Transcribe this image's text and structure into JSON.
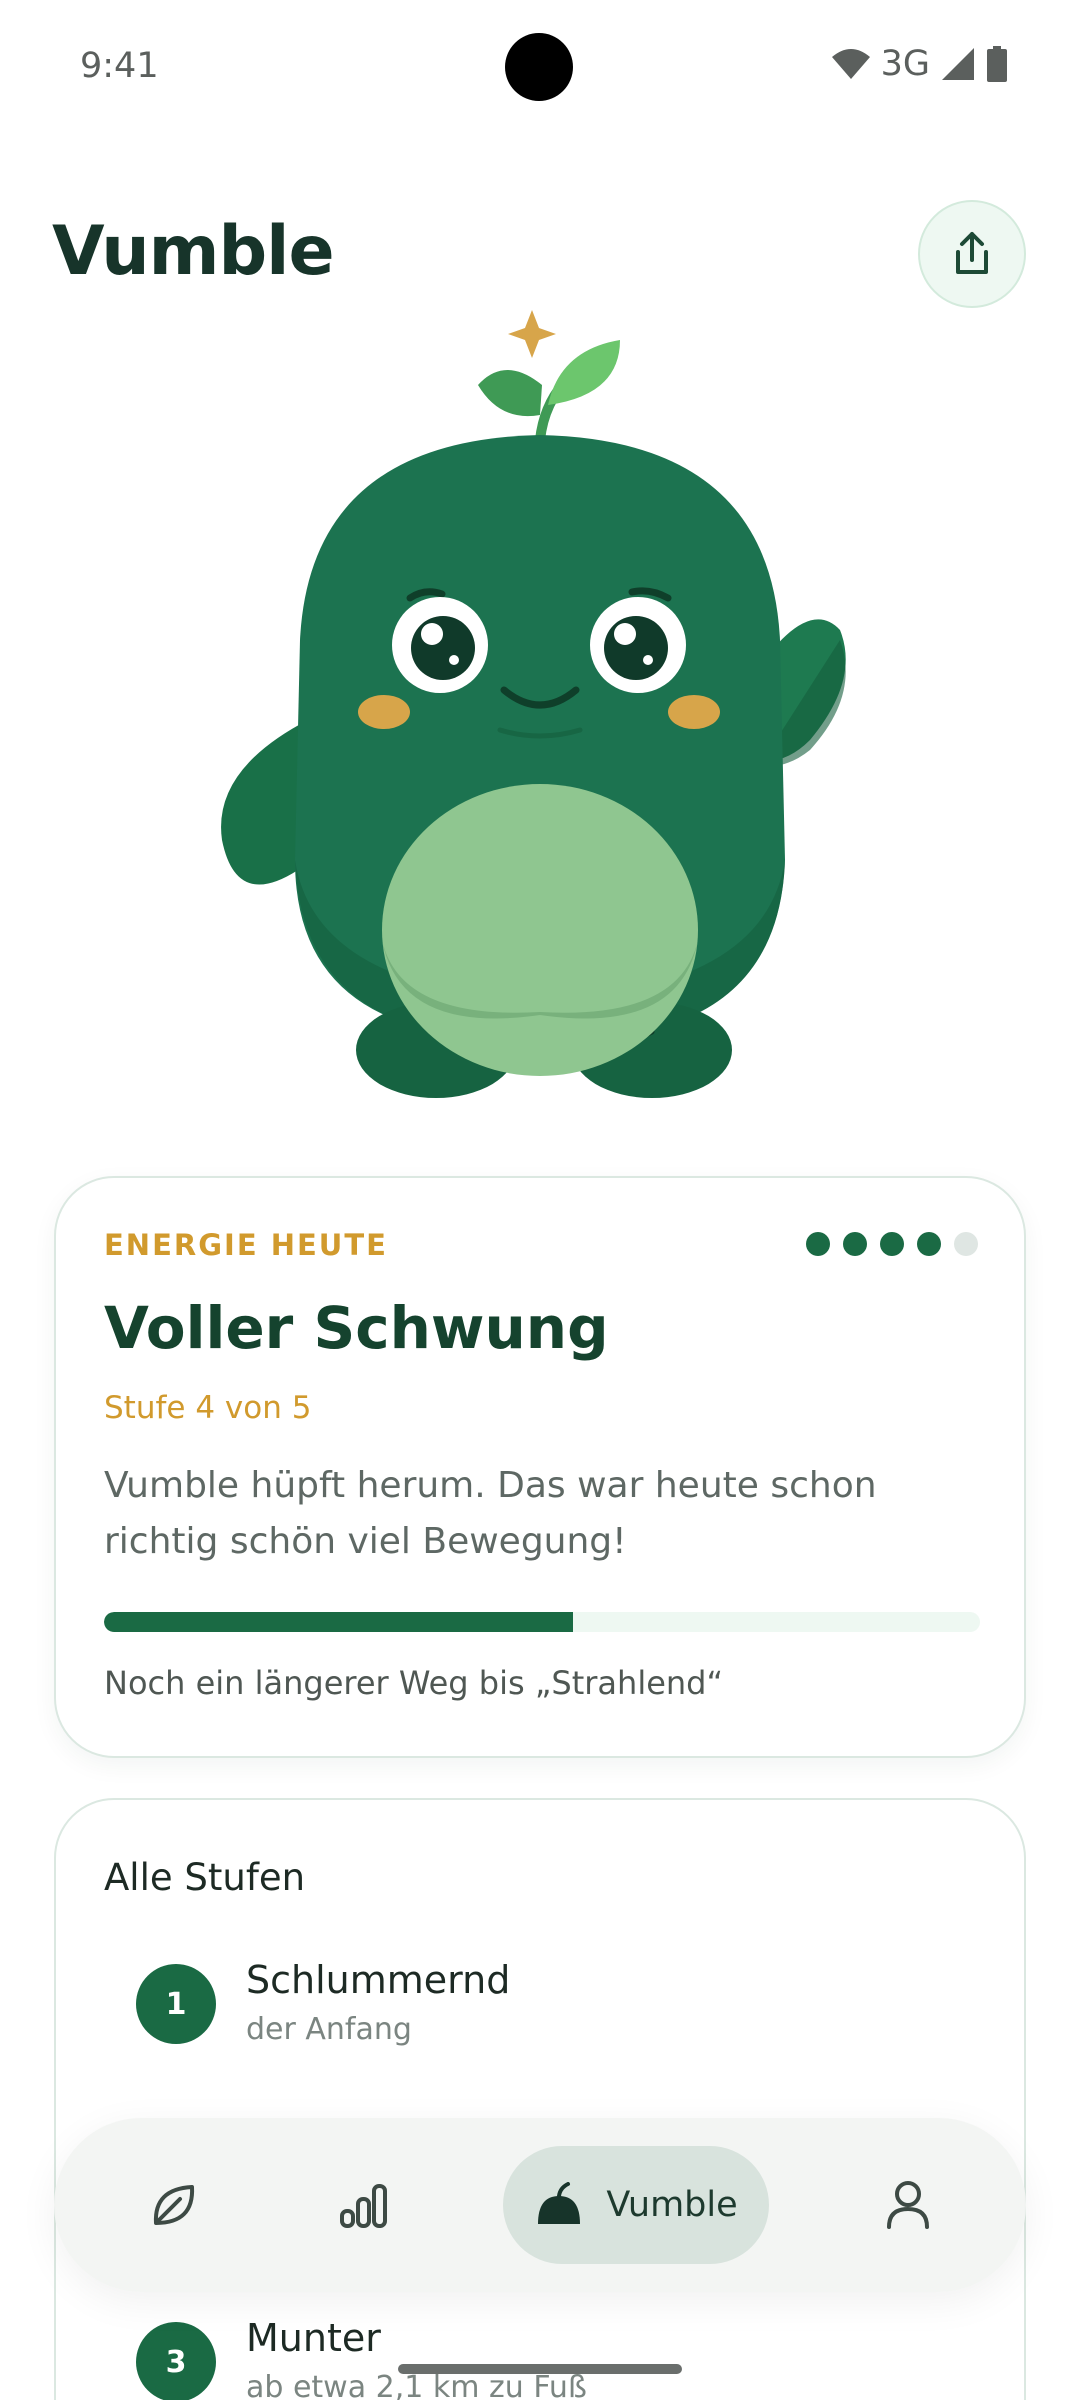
{
  "status_bar": {
    "time": "9:41",
    "network": "3G"
  },
  "header": {
    "title": "Vumble"
  },
  "energy": {
    "eyebrow": "ENERGIE HEUTE",
    "title": "Voller Schwung",
    "level_text": "Stufe 4 von 5",
    "description": "Vumble hüpft herum. Das war heute schon richtig schön viel Bewegung!",
    "progress": 0.535,
    "footer": "Noch ein längerer Weg bis „Strahlend“",
    "dots_filled": 4,
    "dots_total": 5
  },
  "levels": {
    "title": "Alle Stufen",
    "items": [
      {
        "number": "1",
        "name": "Schlummernd",
        "desc": "der Anfang"
      },
      {
        "number": "3",
        "name": "Munter",
        "desc": "ab etwa 2,1 km zu Fuß"
      }
    ]
  },
  "nav": {
    "items": [
      {
        "icon": "leaf-icon"
      },
      {
        "icon": "stats-icon"
      },
      {
        "icon": "mascot-icon",
        "label": "Vumble",
        "active": true
      },
      {
        "icon": "profile-icon"
      }
    ]
  },
  "colors": {
    "primary": "#1a6a44",
    "accent": "#d19a2d",
    "light": "#eef8f2",
    "mascot_body": "#1c7350",
    "mascot_belly": "#8fc690"
  }
}
